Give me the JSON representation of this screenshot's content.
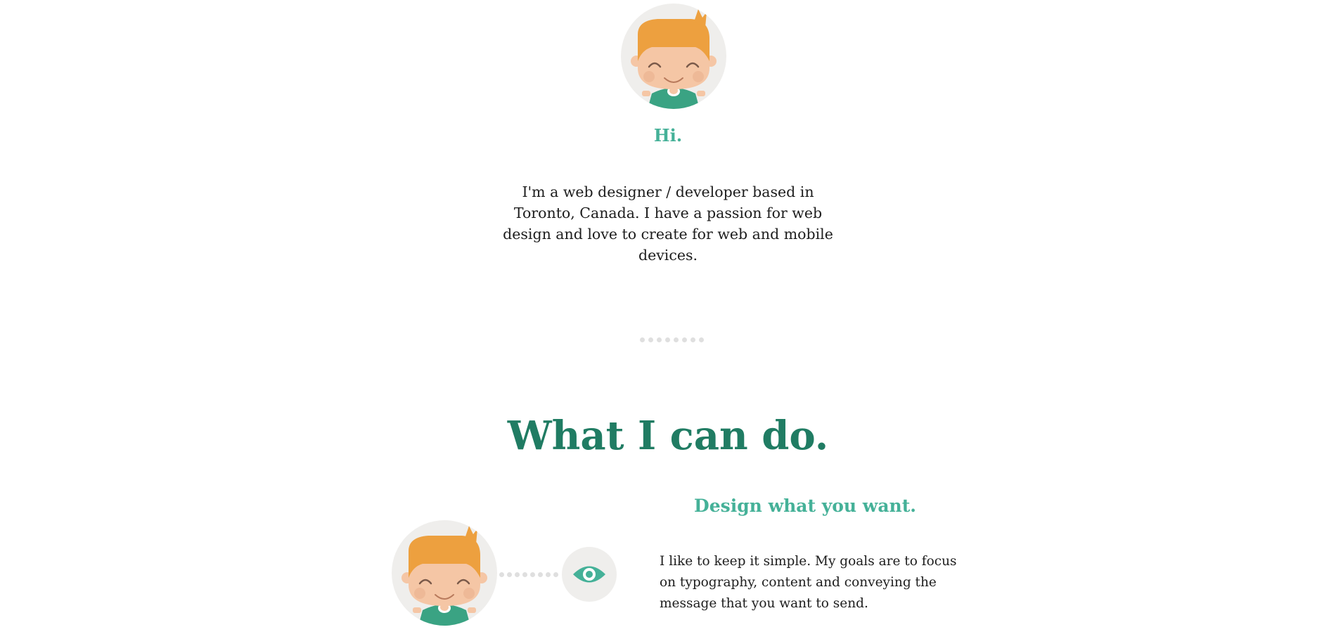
{
  "about": {
    "avatar_icon": "boy-avatar-icon",
    "greeting": "Hi.",
    "intro": "I'm a web designer / developer based in Toronto, Canada. I have a passion for web design and love to create for web and mobile devices."
  },
  "divider": {
    "icon": "dotted-divider"
  },
  "skills": {
    "title": "What I can do.",
    "items": [
      {
        "title": "Design what you want.",
        "description": "I like to keep it simple. My goals are to focus on typography, content and conveying the message that you want to send.",
        "icon": "eye-icon",
        "avatar_icon": "boy-avatar-icon"
      }
    ]
  },
  "colors": {
    "accent": "#45b198",
    "heading": "#207c63",
    "hair": "#eda03f",
    "shirt": "#3aa383",
    "skin": "#f5c6a5",
    "circle_bg": "#efeeec",
    "dots": "#dfdfdf"
  }
}
